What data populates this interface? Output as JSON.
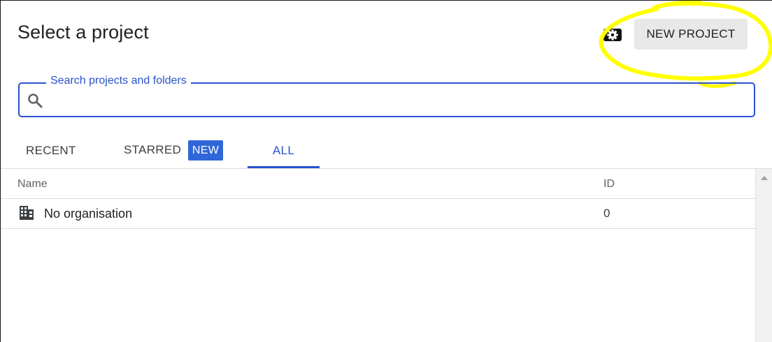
{
  "dialog": {
    "title": "Select a project"
  },
  "header": {
    "settings_icon": "gear-icon",
    "new_project_label": "NEW PROJECT",
    "annotation_color": "#ffff00"
  },
  "search": {
    "label": "Search projects and folders",
    "value": "",
    "icon": "search-icon",
    "border_color": "#2952cc"
  },
  "tabs": [
    {
      "label": "RECENT",
      "active": false
    },
    {
      "label": "STARRED",
      "active": false,
      "badge": "NEW"
    },
    {
      "label": "ALL",
      "active": true
    }
  ],
  "table": {
    "columns": [
      "Name",
      "ID"
    ],
    "rows": [
      {
        "icon": "building-icon",
        "name": "No organisation",
        "id": "0"
      }
    ]
  },
  "colors": {
    "accent": "#2952cc",
    "badge": "#2f67d8",
    "button_bg": "#e8e8e8"
  }
}
